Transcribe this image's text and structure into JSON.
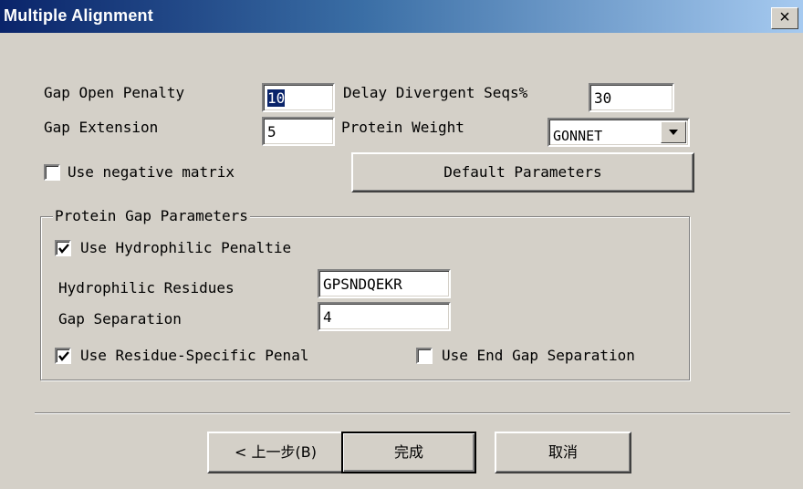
{
  "window": {
    "title": "Multiple Alignment",
    "close_glyph": "×"
  },
  "params": {
    "gap_open_penalty_label": "Gap Open Penalty",
    "gap_open_penalty_value": "10",
    "gap_extension_label": "Gap Extension",
    "gap_extension_value": "5",
    "delay_divergent_label": "Delay Divergent Seqs%",
    "delay_divergent_value": "30",
    "protein_weight_label": "Protein Weight",
    "protein_weight_value": "GONNET",
    "use_negative_matrix_label": "Use negative matrix",
    "use_negative_matrix_checked": false,
    "default_parameters_label": "Default Parameters"
  },
  "protein_gap": {
    "group_title": "Protein Gap Parameters",
    "use_hydrophilic_label": "Use Hydrophilic Penaltie",
    "use_hydrophilic_checked": true,
    "hydrophilic_residues_label": "Hydrophilic Residues",
    "hydrophilic_residues_value": "GPSNDQEKR",
    "gap_separation_label": "Gap Separation",
    "gap_separation_value": "4",
    "use_residue_specific_label": "Use Residue-Specific Penal",
    "use_residue_specific_checked": true,
    "use_end_gap_label": "Use End Gap Separation",
    "use_end_gap_checked": false
  },
  "footer": {
    "back_label": "< 上一步(B)",
    "finish_label": "完成",
    "cancel_label": "取消"
  }
}
